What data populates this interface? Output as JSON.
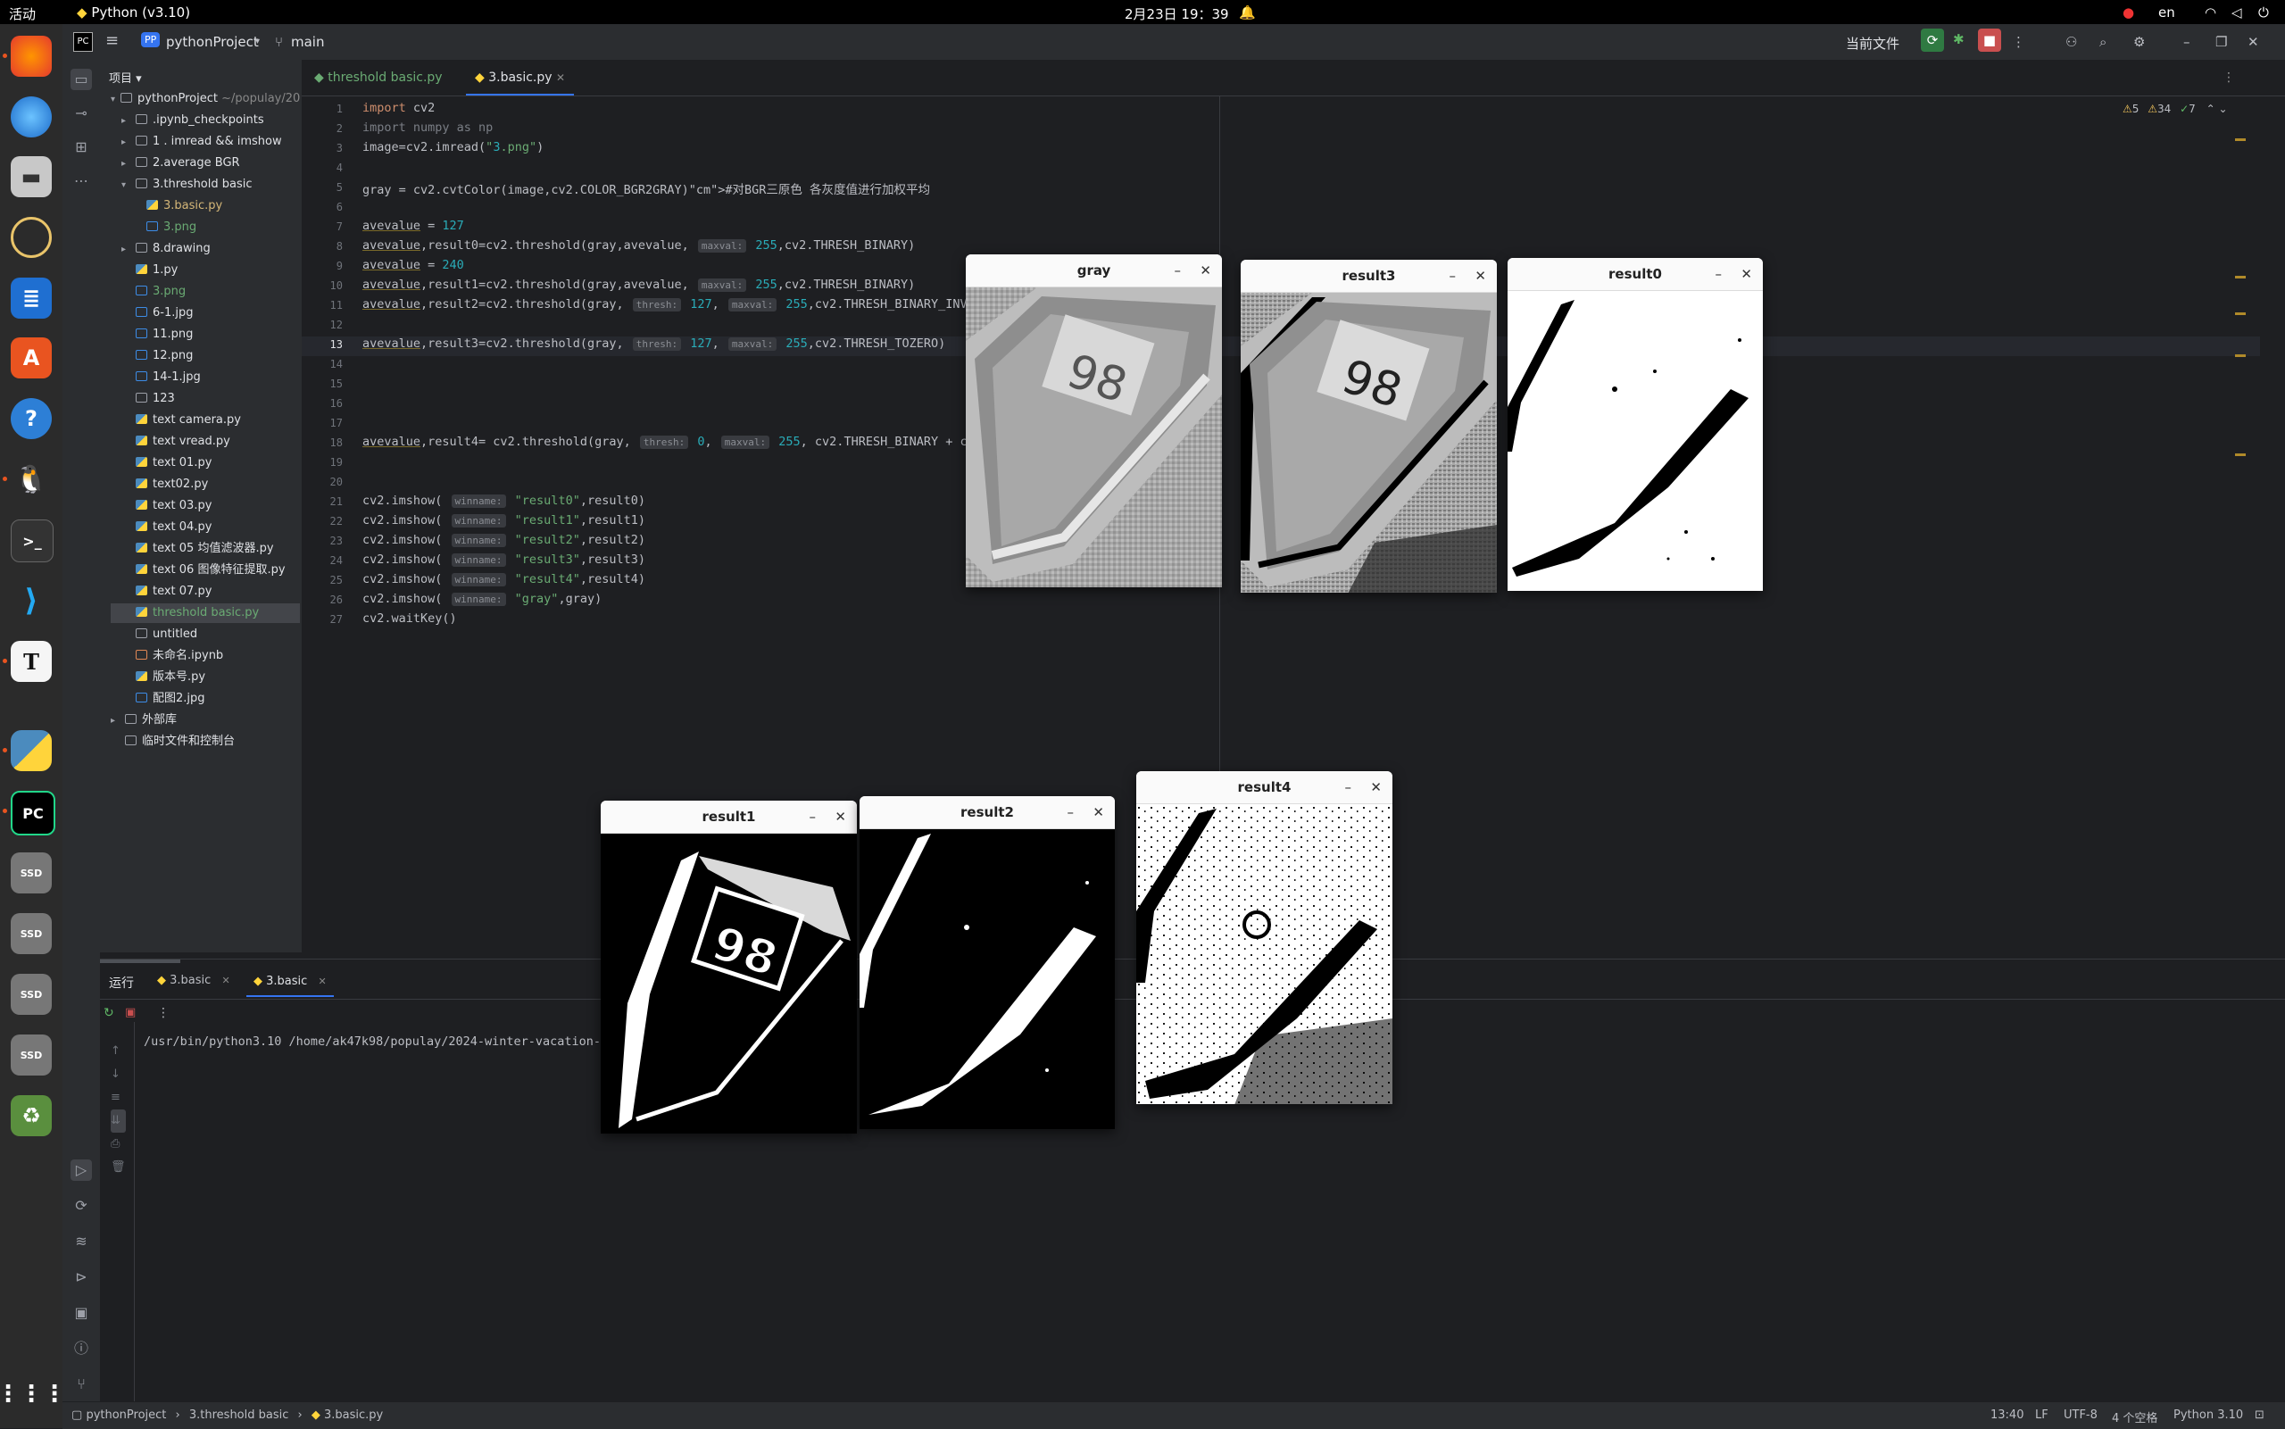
{
  "topbar": {
    "activities": "活动",
    "app": "Python (v3.10)",
    "clock": "2月23日  19：39",
    "lang": "en"
  },
  "ide": {
    "project_badge": "PP",
    "project_name": "pythonProject",
    "branch": "main",
    "current_file": "当前文件"
  },
  "project_panel": {
    "title": "项目",
    "root": "pythonProject",
    "root_path": "~/populay/20",
    "items": [
      {
        "label": ".ipynb_checkpoints",
        "kind": "folder",
        "depth": 1,
        "arrow": true
      },
      {
        "label": "1 .     imread   && imshow",
        "kind": "folder",
        "depth": 1,
        "arrow": true
      },
      {
        "label": "2.average BGR",
        "kind": "folder",
        "depth": 1,
        "arrow": true
      },
      {
        "label": "3.threshold basic",
        "kind": "folder",
        "depth": 1,
        "arrow": true,
        "open": true
      },
      {
        "label": "3.basic.py",
        "kind": "py",
        "depth": 2,
        "color": "#d5b778"
      },
      {
        "label": "3.png",
        "kind": "img",
        "depth": 2,
        "color": "#6aab73"
      },
      {
        "label": "8.drawing",
        "kind": "folder",
        "depth": 1,
        "arrow": true
      },
      {
        "label": "1.py",
        "kind": "py",
        "depth": 1
      },
      {
        "label": "3.png",
        "kind": "img",
        "depth": 1,
        "color": "#6aab73"
      },
      {
        "label": "6-1.jpg",
        "kind": "img",
        "depth": 1
      },
      {
        "label": "11.png",
        "kind": "img",
        "depth": 1
      },
      {
        "label": "12.png",
        "kind": "img",
        "depth": 1
      },
      {
        "label": "14-1.jpg",
        "kind": "img",
        "depth": 1
      },
      {
        "label": "123",
        "kind": "txt",
        "depth": 1
      },
      {
        "label": "text camera.py",
        "kind": "py",
        "depth": 1
      },
      {
        "label": "text vread.py",
        "kind": "py",
        "depth": 1
      },
      {
        "label": "text 01.py",
        "kind": "py",
        "depth": 1
      },
      {
        "label": "text02.py",
        "kind": "py",
        "depth": 1
      },
      {
        "label": "text 03.py",
        "kind": "py",
        "depth": 1
      },
      {
        "label": "text 04.py",
        "kind": "py",
        "depth": 1
      },
      {
        "label": "text 05 均值滤波器.py",
        "kind": "py",
        "depth": 1
      },
      {
        "label": "text 06 图像特征提取.py",
        "kind": "py",
        "depth": 1
      },
      {
        "label": "text 07.py",
        "kind": "py",
        "depth": 1
      },
      {
        "label": "threshold  basic.py",
        "kind": "py",
        "depth": 1,
        "color": "#6aab73",
        "selected": true
      },
      {
        "label": "untitled",
        "kind": "txt",
        "depth": 1
      },
      {
        "label": "未命名.ipynb",
        "kind": "nb",
        "depth": 1
      },
      {
        "label": "版本号.py",
        "kind": "py",
        "depth": 1
      },
      {
        "label": "配图2.jpg",
        "kind": "img",
        "depth": 1
      }
    ],
    "external": "外部库",
    "scratch": "临时文件和控制台"
  },
  "tabs": [
    {
      "label": "threshold  basic.py",
      "active": false
    },
    {
      "label": "3.basic.py",
      "active": true
    }
  ],
  "inspections": {
    "warnings": "5",
    "weak": "34",
    "ok": "7"
  },
  "code_lines": [
    "import cv2",
    "import numpy as np",
    "image=cv2.imread(\"3.png\")",
    "",
    "gray = cv2.cvtColor(image,cv2.COLOR_BGR2GRAY)#对BGR三原色 各灰度值进行加权平均",
    "",
    "avevalue = 127",
    "avevalue,result0=cv2.threshold(gray,avevalue, maxval: 255,cv2.THRESH_BINARY)",
    "avevalue = 240",
    "avevalue,result1=cv2.threshold(gray,avevalue, maxval: 255,cv2.THRESH_BINARY)",
    "avevalue,result2=cv2.threshold(gray, thresh: 127, maxval: 255,cv2.THRESH_BINARY_INV)",
    "",
    "avevalue,result3=cv2.threshold(gray, thresh: 127, maxval: 255,cv2.THRESH_TOZERO)",
    "",
    "",
    "",
    "",
    "avevalue,result4= cv2.threshold(gray, thresh: 0, maxval: 255, cv2.THRESH_BINARY + cv2.T",
    "",
    "",
    "cv2.imshow( winname: \"result0\",result0)",
    "cv2.imshow( winname: \"result1\",result1)",
    "cv2.imshow( winname: \"result2\",result2)",
    "cv2.imshow( winname: \"result3\",result3)",
    "cv2.imshow( winname: \"result4\",result4)",
    "cv2.imshow( winname: \"gray\",gray)",
    "cv2.waitKey()"
  ],
  "run": {
    "label": "运行",
    "tab1": "3.basic",
    "tab2": "3.basic",
    "output": "/usr/bin/python3.10 /home/ak47k98/populay/2024-winter-vacation-t"
  },
  "windows": {
    "gray": "gray",
    "result3": "result3",
    "result0": "result0",
    "result1": "result1",
    "result2": "result2",
    "result4": "result4",
    "min": "–",
    "close": "✕"
  },
  "statusbar": {
    "crumb1": "pythonProject",
    "crumb2": "3.threshold basic",
    "crumb3": "3.basic.py",
    "pos": "13:40",
    "eol": "LF",
    "enc": "UTF-8",
    "indent": "4 个空格",
    "interp": "Python 3.10"
  }
}
